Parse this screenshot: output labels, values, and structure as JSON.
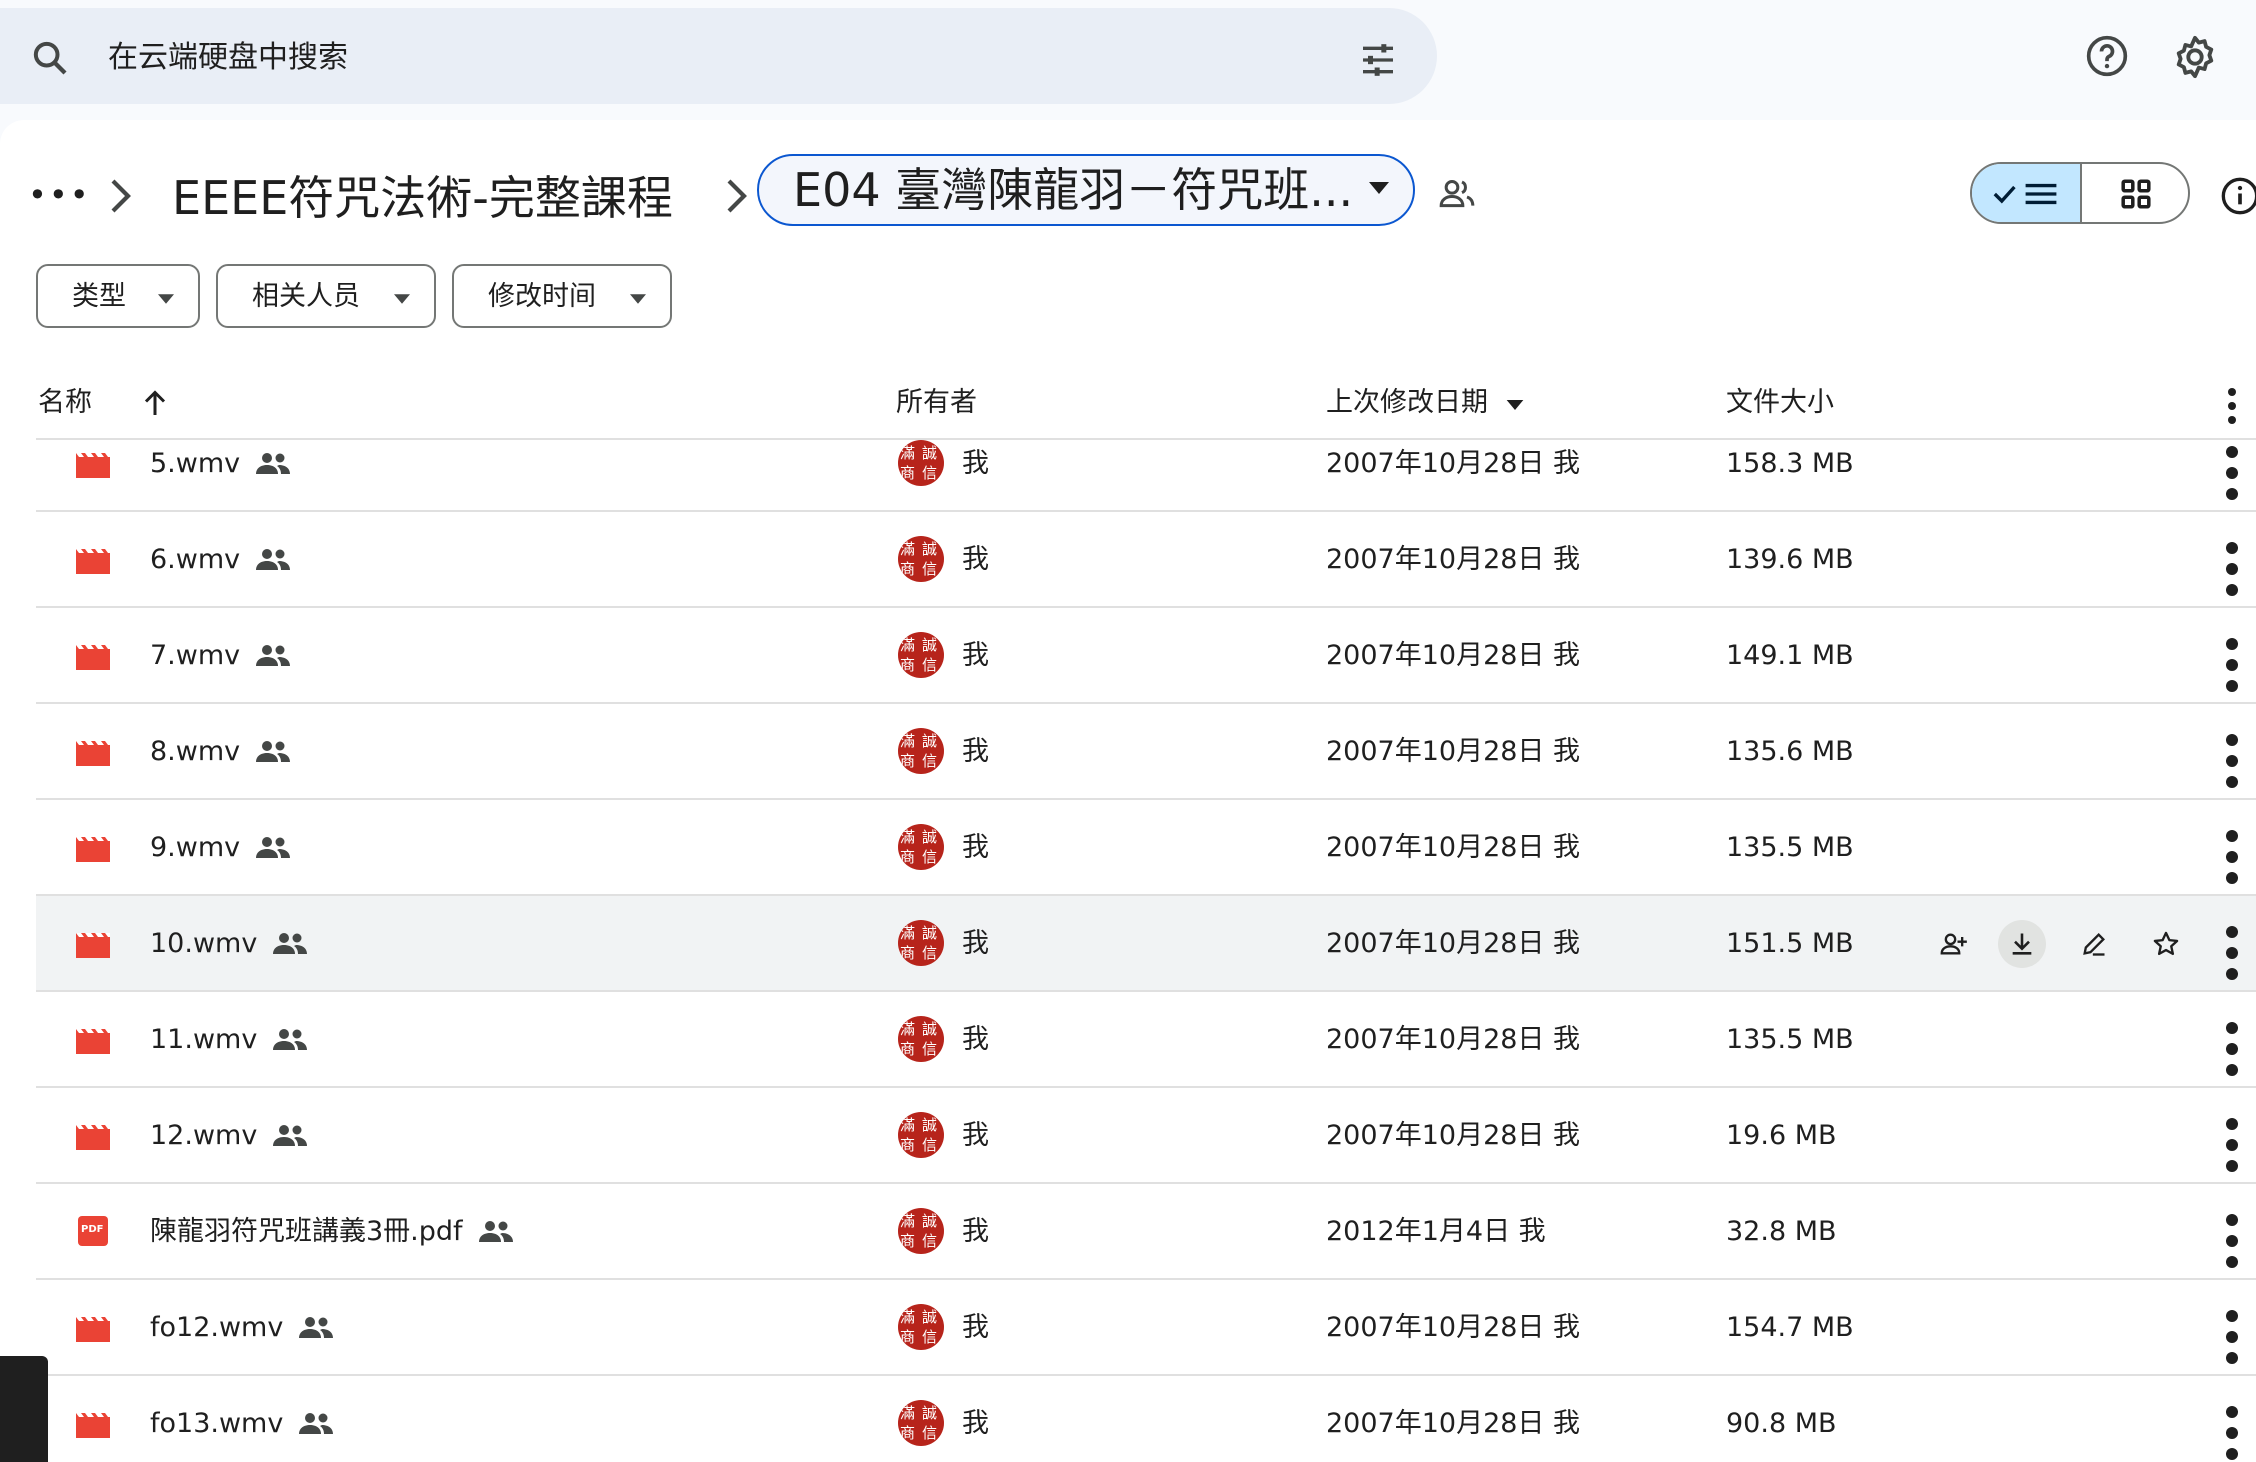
{
  "search": {
    "placeholder": "在云端硬盘中搜索"
  },
  "breadcrumb": {
    "more": "•••",
    "parent": "EEEE符咒法術-完整課程",
    "current": "E04 臺灣陳龍羽－符咒班..."
  },
  "filters": {
    "type": "类型",
    "people": "相关人员",
    "modified": "修改时间"
  },
  "columns": {
    "name": "名称",
    "owner": "所有者",
    "modified": "上次修改日期",
    "size": "文件大小"
  },
  "files": [
    {
      "name": "5.wmv",
      "kind": "video",
      "owner": "我",
      "date": "2007年10月28日 我",
      "size": "158.3 MB"
    },
    {
      "name": "6.wmv",
      "kind": "video",
      "owner": "我",
      "date": "2007年10月28日 我",
      "size": "139.6 MB"
    },
    {
      "name": "7.wmv",
      "kind": "video",
      "owner": "我",
      "date": "2007年10月28日 我",
      "size": "149.1 MB"
    },
    {
      "name": "8.wmv",
      "kind": "video",
      "owner": "我",
      "date": "2007年10月28日 我",
      "size": "135.6 MB"
    },
    {
      "name": "9.wmv",
      "kind": "video",
      "owner": "我",
      "date": "2007年10月28日 我",
      "size": "135.5 MB"
    },
    {
      "name": "10.wmv",
      "kind": "video",
      "owner": "我",
      "date": "2007年10月28日 我",
      "size": "151.5 MB"
    },
    {
      "name": "11.wmv",
      "kind": "video",
      "owner": "我",
      "date": "2007年10月28日 我",
      "size": "135.5 MB"
    },
    {
      "name": "12.wmv",
      "kind": "video",
      "owner": "我",
      "date": "2007年10月28日 我",
      "size": "19.6 MB"
    },
    {
      "name": "陳龍羽符咒班講義3冊.pdf",
      "kind": "pdf",
      "owner": "我",
      "date": "2012年1月4日 我",
      "size": "32.8 MB"
    },
    {
      "name": "fo12.wmv",
      "kind": "video",
      "owner": "我",
      "date": "2007年10月28日 我",
      "size": "154.7 MB"
    },
    {
      "name": "fo13.wmv",
      "kind": "video",
      "owner": "我",
      "date": "2007年10月28日 我",
      "size": "90.8 MB"
    }
  ],
  "avatar_glyphs": [
    "滿",
    "誠",
    "商",
    "信"
  ],
  "pdf_label": "PDF",
  "colors": {
    "video": "#ea4335",
    "accent": "#0b57d0",
    "selected": "#c2e7ff"
  }
}
